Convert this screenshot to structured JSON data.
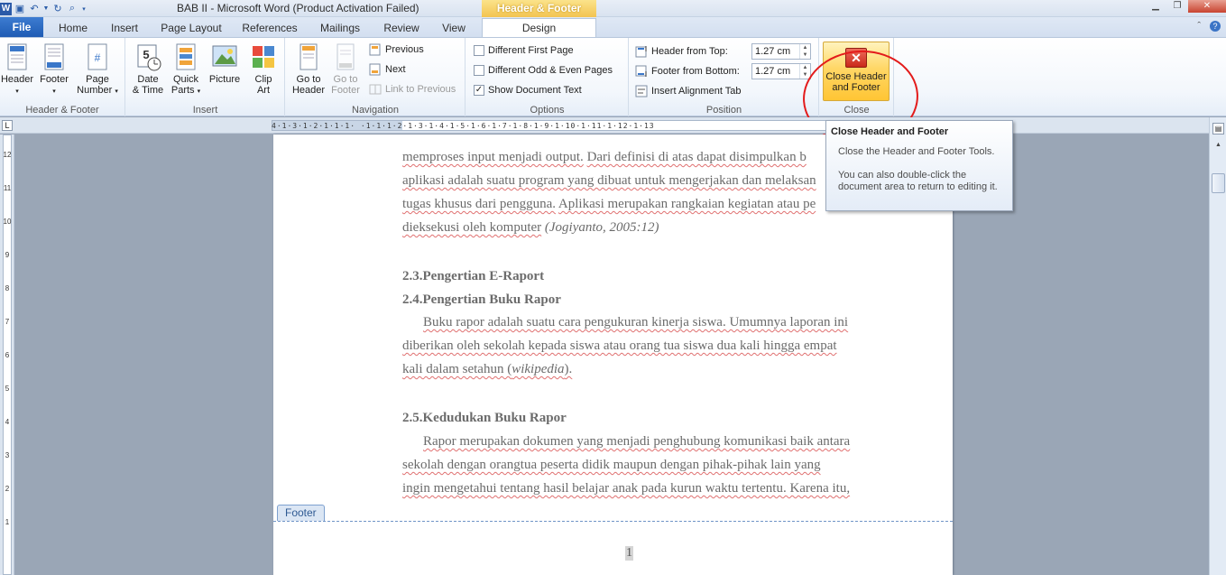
{
  "window": {
    "title": "BAB II  -  Microsoft Word (Product Activation Failed)",
    "context_tab_label": "Header & Footer Tools"
  },
  "quick_access": [
    "word-icon",
    "save-icon",
    "undo-icon",
    "undo-dropdown-icon",
    "redo-icon",
    "print-preview-icon",
    "customize-icon"
  ],
  "tabs": {
    "file": "File",
    "home": "Home",
    "insert": "Insert",
    "page_layout": "Page Layout",
    "references": "References",
    "mailings": "Mailings",
    "review": "Review",
    "view": "View",
    "design": "Design"
  },
  "ribbon": {
    "header_footer": {
      "label": "Header & Footer",
      "header": "Header",
      "footer": "Footer",
      "page_number_1": "Page",
      "page_number_2": "Number"
    },
    "insert": {
      "label": "Insert",
      "date_time_1": "Date",
      "date_time_2": "& Time",
      "quick_parts_1": "Quick",
      "quick_parts_2": "Parts",
      "picture": "Picture",
      "clip_art_1": "Clip",
      "clip_art_2": "Art"
    },
    "navigation": {
      "label": "Navigation",
      "go_to_header_1": "Go to",
      "go_to_header_2": "Header",
      "go_to_footer_1": "Go to",
      "go_to_footer_2": "Footer",
      "previous": "Previous",
      "next": "Next",
      "link_to_previous": "Link to Previous"
    },
    "options": {
      "label": "Options",
      "different_first_page": "Different First Page",
      "different_odd_even": "Different Odd & Even Pages",
      "show_document_text": "Show Document Text",
      "show_document_text_checked": "✓"
    },
    "position": {
      "label": "Position",
      "header_from_top_label": "Header from Top:",
      "header_from_top_value": "1.27 cm",
      "footer_from_bottom_label": "Footer from Bottom:",
      "footer_from_bottom_value": "1.27 cm",
      "insert_alignment_tab": "Insert Alignment Tab"
    },
    "close": {
      "label": "Close",
      "close_button_1": "Close Header",
      "close_button_2": "and Footer"
    }
  },
  "ruler": {
    "text": "4·1·3·1·2·1·1·1·  ·1·1·1·2·1·3·1·4·1·5·1·6·1·7·1·8·1·9·1·10·1·11·1·12·1·13"
  },
  "vertical_ruler_numbers": [
    "12",
    "11",
    "10",
    "9",
    "8",
    "7",
    "6",
    "5",
    "4",
    "3",
    "2",
    "1"
  ],
  "tooltip": {
    "title": "Close Header and Footer",
    "line1": "Close the Header and Footer Tools.",
    "line2": "You can also double-click the document area to return to editing it."
  },
  "document": {
    "p1_l1a": "memproses input menjadi output.",
    "p1_l1b": "Dari definisi di atas dapat disimpulkan b",
    "p1_l2a": "aplikasi adalah suatu program yang dibuat untuk mengerjakan dan melaksan",
    "p1_l3a": "tugas khusus dari pengguna.",
    "p1_l3b": "Aplikasi merupakan rangkaian kegiatan atau pe",
    "p1_l4a": "dieksekusi oleh komputer",
    "p1_l4b": "(Jogiyanto, 2005:12)",
    "h23": "2.3.Pengertian E-Raport",
    "h24": "2.4.Pengertian Buku Rapor",
    "p2_l1": "Buku rapor adalah suatu cara pengukuran kinerja siswa. Umumnya laporan ini",
    "p2_l2": "diberikan oleh sekolah kepada siswa atau orang tua siswa dua kali hingga empat",
    "p2_l3a": "kali dalam setahun (",
    "p2_l3b": "wikipedia",
    "p2_l3c": ").",
    "h25": "2.5.Kedudukan Buku Rapor",
    "p3_l1": "Rapor merupakan dokumen yang menjadi penghubung komunikasi baik antara",
    "p3_l2": "sekolah dengan orangtua peserta didik maupun dengan pihak-pihak lain yang",
    "p3_l3": "ingin mengetahui tentang hasil belajar anak pada kurun waktu tertentu. Karena itu,",
    "footer_tag": "Footer",
    "page_number": "1"
  },
  "colors": {
    "annotation_circle": "#e31b1b",
    "context_tab": "#f2c24e",
    "file_tab": "#2b67bd"
  }
}
